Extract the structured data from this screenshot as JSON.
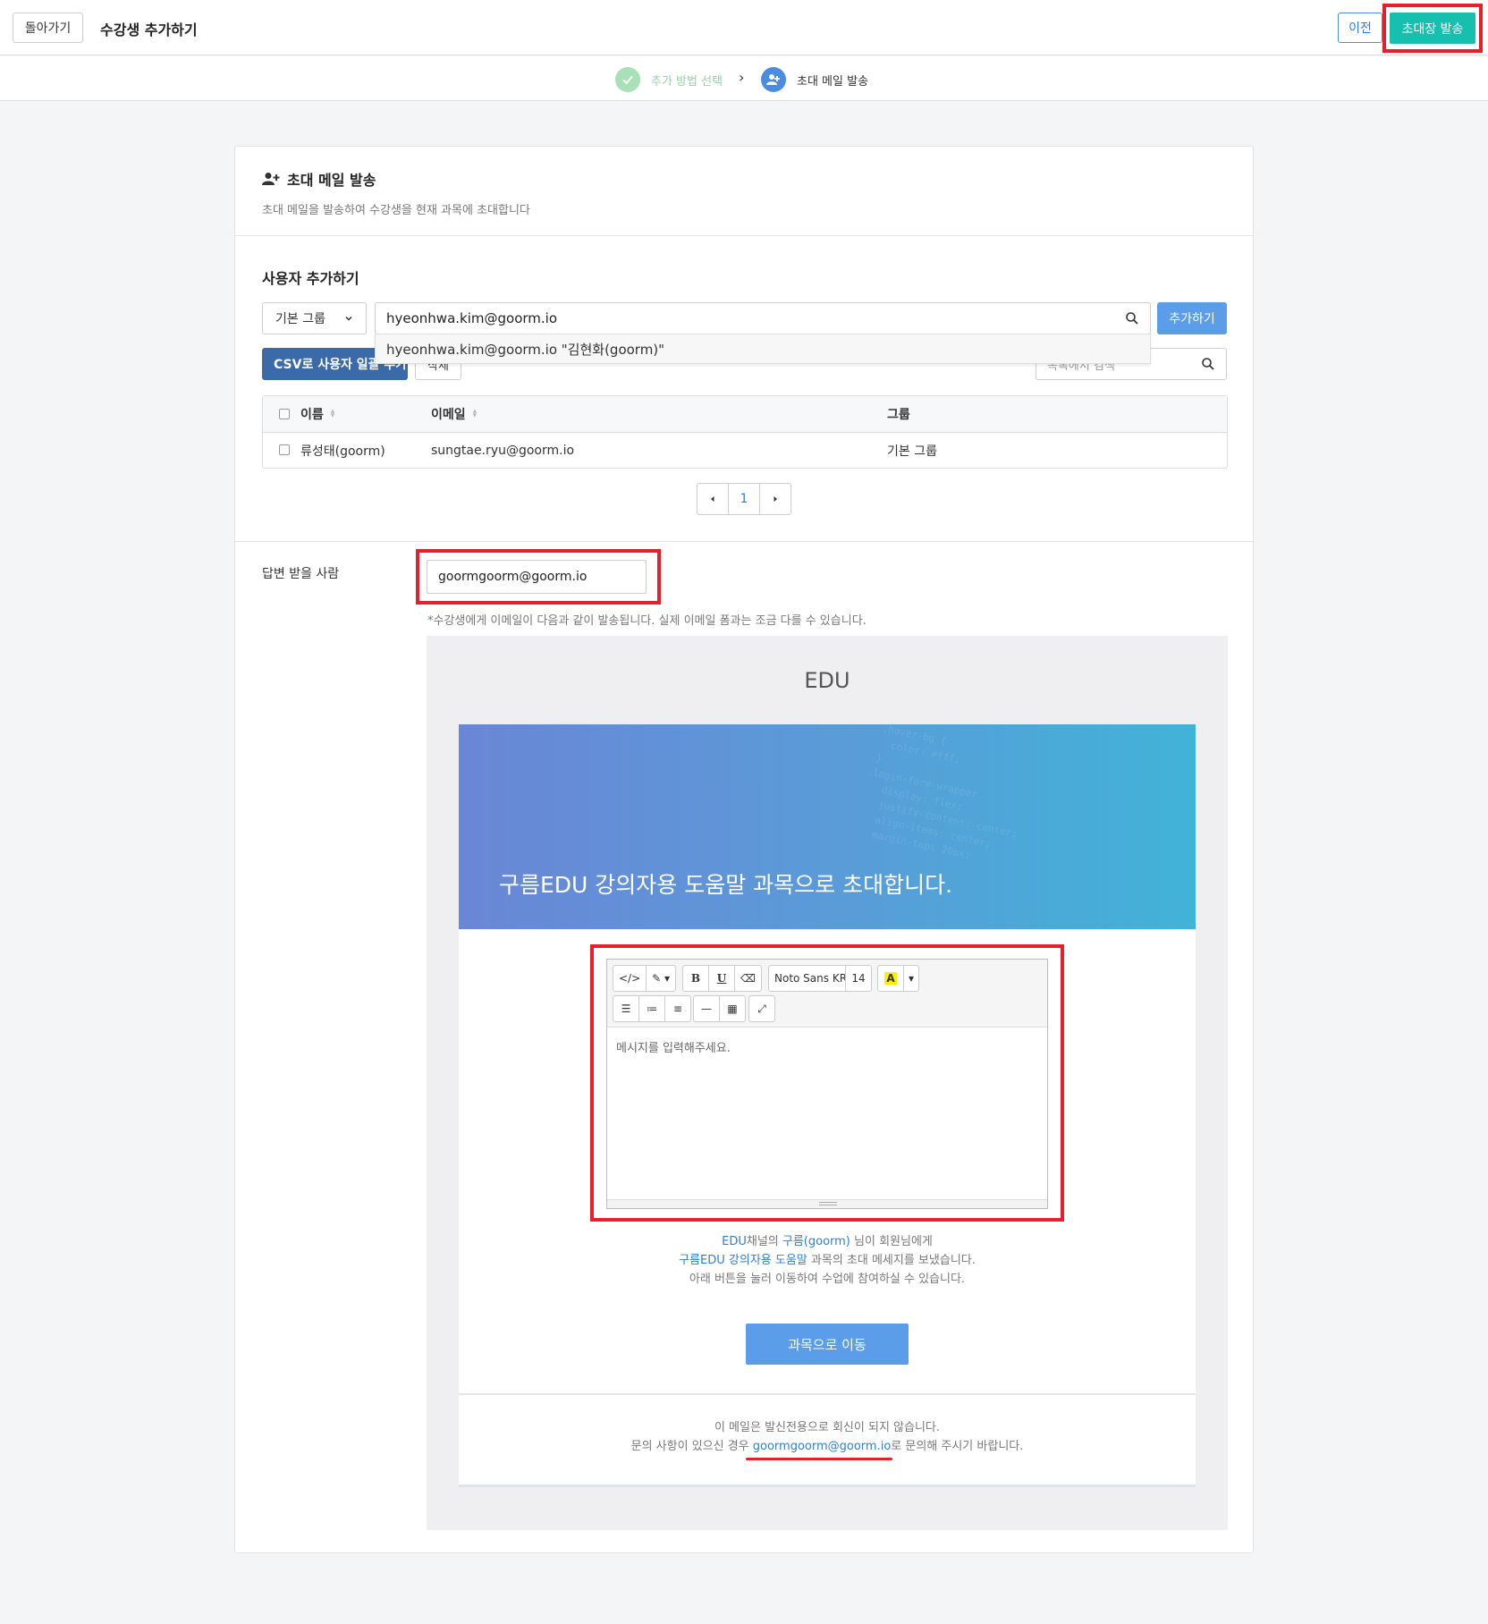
{
  "header": {
    "back_label": "돌아가기",
    "title": "수강생 추가하기",
    "prev_label": "이전",
    "send_label": "초대장 발송"
  },
  "steps": [
    {
      "label": "추가 방법 선택",
      "state": "done"
    },
    {
      "label": "초대 메일 발송",
      "state": "active"
    }
  ],
  "card": {
    "title": "초대 메일 발송",
    "description": "초대 메일을 발송하여 수강생을 현재 과목에 초대합니다"
  },
  "add_user": {
    "section_title": "사용자 추가하기",
    "group_select": "기본 그룹",
    "search_value": "hyeonhwa.kim@goorm.io",
    "add_label": "추가하기",
    "suggestion": "hyeonhwa.kim@goorm.io \"김현화(goorm)\"",
    "csv_label": "CSV로 사용자 일괄 추가",
    "delete_label": "삭제",
    "list_search_placeholder": "목록에서 검색"
  },
  "table": {
    "headers": [
      "이름",
      "이메일",
      "그룹"
    ],
    "rows": [
      {
        "name": "류성태(goorm)",
        "email": "sungtae.ryu@goorm.io",
        "group": "기본 그룹"
      }
    ]
  },
  "pagination": {
    "current": "1"
  },
  "reply": {
    "label": "답변 받을 사람",
    "value": "goormgoorm@goorm.io",
    "note": "*수강생에게 이메일이 다음과 같이 발송됩니다. 실제 이메일 폼과는 조금 다를 수 있습니다."
  },
  "preview": {
    "brand": "EDU",
    "banner_text": "구름EDU 강의자용 도움말 과목으로 초대합니다.",
    "editor": {
      "font": "Noto Sans KR",
      "size": "14",
      "placeholder": "메시지를 입력해주세요."
    },
    "message": {
      "l1_channel": "EDU",
      "l1_a": "채널의 ",
      "l1_user": "구름(goorm)",
      "l1_b": " 님이 회원님에게",
      "l2_course": "구름EDU 강의자용 도움말",
      "l2_b": " 과목의 초대 메세지를 보냈습니다.",
      "l3": "아래 버튼을 눌러 이동하여 수업에 참여하실 수 있습니다."
    },
    "go_label": "과목으로 이동",
    "footer": {
      "l1": "이 메일은 발신전용으로 회신이 되지 않습니다.",
      "l2_a": "문의 사항이 있으신 경우 ",
      "l2_email": "goormgoorm@goorm.io",
      "l2_b": "로 문의해 주시기 바랍니다."
    }
  },
  "colors": {
    "accent": "#17bfae",
    "primary": "#5b9de8",
    "highlight": "#e5202a"
  }
}
